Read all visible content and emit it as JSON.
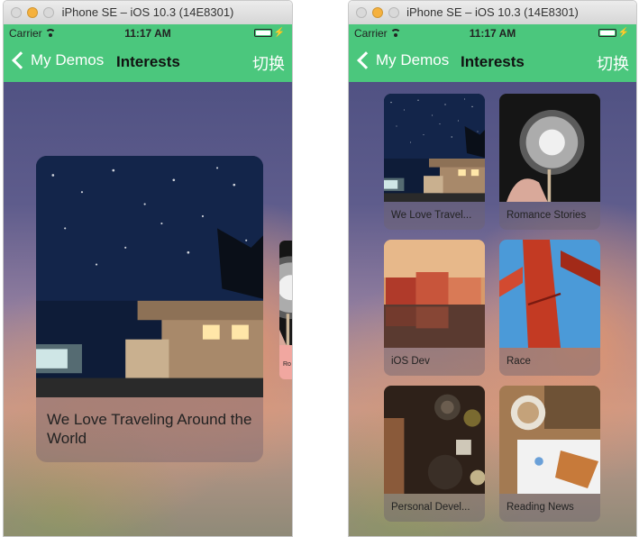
{
  "colors": {
    "accent": "#4bc77d",
    "window_bg": "#f6f6f6"
  },
  "left_window": {
    "title": "iPhone SE – iOS 10.3 (14E8301)",
    "status": {
      "carrier": "Carrier",
      "time": "11:17 AM"
    },
    "nav": {
      "back_label": "My Demos",
      "title": "Interests",
      "switch_label": "切换"
    },
    "main_card": {
      "caption": "We Love Traveling Around the World",
      "image": "travel-camper-photo"
    },
    "peek_card": {
      "caption": "Ro",
      "image": "dandelion-photo"
    }
  },
  "right_window": {
    "title": "iPhone SE – iOS 10.3 (14E8301)",
    "status": {
      "carrier": "Carrier",
      "time": "11:17 AM"
    },
    "nav": {
      "back_label": "My Demos",
      "title": "Interests",
      "switch_label": "切换"
    },
    "tiles": [
      {
        "caption": "We Love Travel...",
        "image": "travel-camper-photo"
      },
      {
        "caption": "Romance Stories",
        "image": "dandelion-photo"
      },
      {
        "caption": "iOS Dev",
        "image": "waterfront-houses-photo"
      },
      {
        "caption": "Race",
        "image": "red-bridge-photo"
      },
      {
        "caption": "Personal Devel...",
        "image": "kitchen-table-photo"
      },
      {
        "caption": "Reading News",
        "image": "coffee-breakfast-photo"
      }
    ]
  }
}
